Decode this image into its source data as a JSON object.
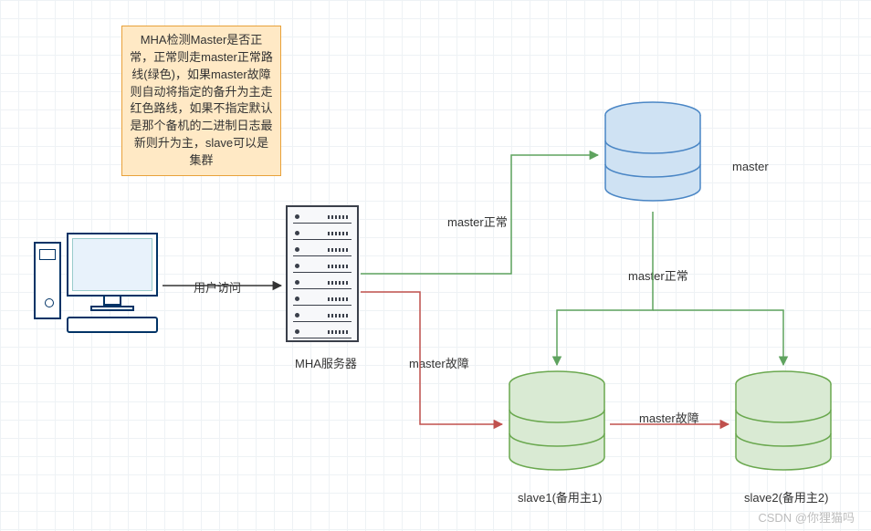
{
  "note_text": "MHA检测Master是否正常，正常则走master正常路线(绿色)，如果master故障则自动将指定的备升为主走红色路线，如果不指定默认是那个备机的二进制日志最新则升为主，slave可以是集群",
  "labels": {
    "user_access": "用户访问",
    "mha_server": "MHA服务器",
    "master_normal_top": "master正常",
    "master_normal_right": "master正常",
    "master_fault_left": "master故障",
    "master_fault_right": "master故障",
    "master": "master",
    "slave1": "slave1(备用主1)",
    "slave2": "slave2(备用主2)"
  },
  "colors": {
    "normal_path": "#5fa35f",
    "fault_path": "#c0504d",
    "master_db_fill": "#cfe2f3",
    "master_db_stroke": "#4a86c5",
    "slave_db_fill": "#d9ead3",
    "slave_db_stroke": "#6aa84f",
    "note_bg": "#ffe9c5",
    "note_border": "#e8a13a"
  },
  "watermark": "CSDN @你狸猫吗",
  "chart_data": {
    "type": "diagram",
    "title": "MHA MySQL高可用架构",
    "nodes": [
      {
        "id": "client",
        "type": "computer",
        "label": "用户访问"
      },
      {
        "id": "mha",
        "type": "server",
        "label": "MHA服务器"
      },
      {
        "id": "master",
        "type": "database",
        "label": "master",
        "color": "blue"
      },
      {
        "id": "slave1",
        "type": "database",
        "label": "slave1(备用主1)",
        "color": "green"
      },
      {
        "id": "slave2",
        "type": "database",
        "label": "slave2(备用主2)",
        "color": "green"
      }
    ],
    "edges": [
      {
        "from": "client",
        "to": "mha",
        "label": "用户访问",
        "color": "black"
      },
      {
        "from": "mha",
        "to": "master",
        "label": "master正常",
        "color": "green"
      },
      {
        "from": "master",
        "to": "slave1",
        "label": "master正常",
        "color": "green"
      },
      {
        "from": "master",
        "to": "slave2",
        "label": "master正常",
        "color": "green"
      },
      {
        "from": "mha",
        "to": "slave1",
        "label": "master故障",
        "color": "red"
      },
      {
        "from": "slave1",
        "to": "slave2",
        "label": "master故障",
        "color": "red"
      }
    ],
    "annotation": "MHA检测Master是否正常，正常则走master正常路线(绿色)，如果master故障则自动将指定的备升为主走红色路线，如果不指定默认是那个备机的二进制日志最新则升为主，slave可以是集群"
  }
}
